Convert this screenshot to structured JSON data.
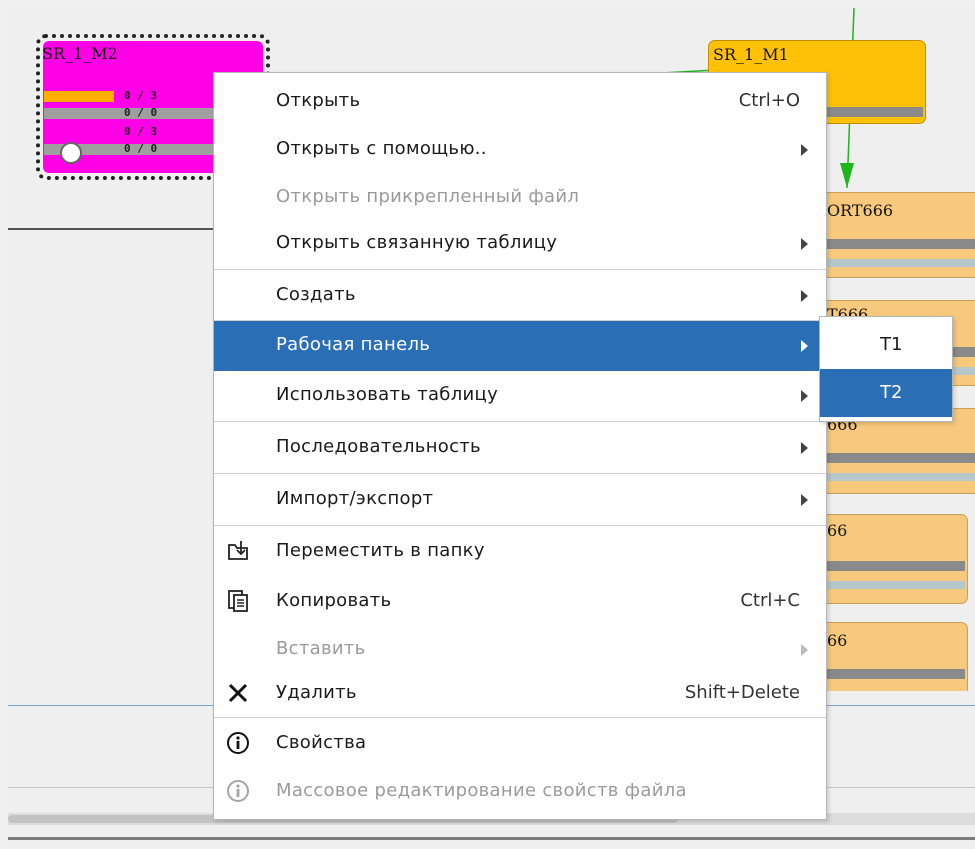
{
  "canvas": {
    "nodes": {
      "m2": {
        "label": "SR_1_M2",
        "rows": [
          {
            "value": "0 / 3",
            "fill": 0.4
          },
          {
            "value": "0 / 0",
            "fill": 0
          },
          {
            "value": "0 / 3",
            "fill": 0
          },
          {
            "value": "0 / 0",
            "fill": 0
          }
        ],
        "color": "#ff00e6"
      },
      "m1": {
        "label": "SR_1_M1",
        "color": "#ffc107"
      },
      "p1": {
        "label": "ORT666"
      },
      "p2": {
        "label": "T666"
      },
      "p3": {
        "label": "666"
      },
      "p4": {
        "label": "66"
      },
      "p5": {
        "label": "66"
      },
      "orange_color": "#f7c97d"
    },
    "connector_color": "#1fb51f"
  },
  "context_menu": {
    "highlight_color": "#2a6eb6",
    "items": [
      {
        "label": "Открыть",
        "shortcut": "Ctrl+O"
      },
      {
        "label": "Открыть с помощью.."
      },
      {
        "label": "Открыть прикрепленный файл"
      },
      {
        "label": "Открыть связанную таблицу"
      },
      {
        "label": "Создать"
      },
      {
        "label": "Рабочая панель"
      },
      {
        "label": "Использовать таблицу"
      },
      {
        "label": "Последовательность"
      },
      {
        "label": "Импорт/экспорт"
      },
      {
        "label": "Переместить в папку",
        "icon": "move-to-folder-icon"
      },
      {
        "label": "Копировать",
        "shortcut": "Ctrl+C",
        "icon": "copy-icon"
      },
      {
        "label": "Вставить"
      },
      {
        "label": "Удалить",
        "shortcut": "Shift+Delete",
        "icon": "close-icon"
      },
      {
        "label": "Свойства",
        "icon": "info-icon"
      },
      {
        "label": "Массовое редактирование свойств файла",
        "icon": "info-icon"
      }
    ]
  },
  "submenu": {
    "items": [
      {
        "label": "T1"
      },
      {
        "label": "T2"
      }
    ]
  }
}
